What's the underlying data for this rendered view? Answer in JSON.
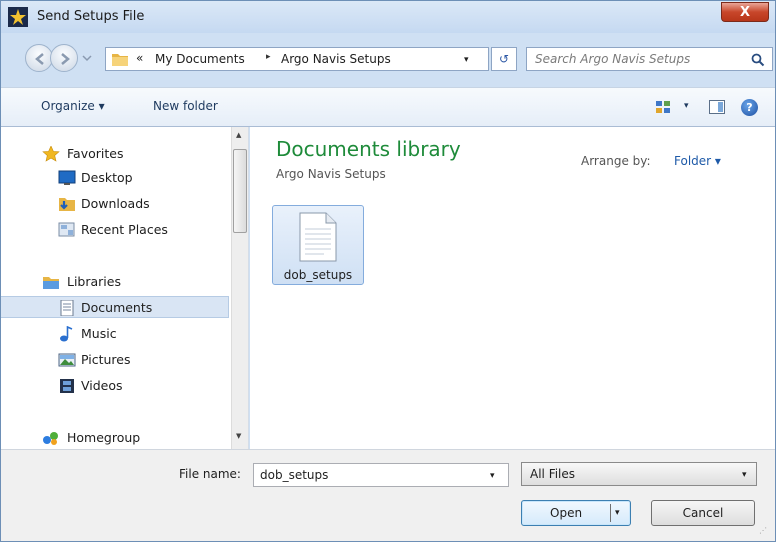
{
  "window": {
    "title": "Send Setups File",
    "close_glyph": "X"
  },
  "address": {
    "overflow": "«",
    "crumbs": [
      "My Documents",
      "Argo Navis Setups"
    ],
    "separator": "▸",
    "dropdown": "▾",
    "refresh_glyph": "↺"
  },
  "search": {
    "placeholder": "Search Argo Navis Setups"
  },
  "toolbar": {
    "organize": "Organize ▾",
    "new_folder": "New folder",
    "views_arrow": "▾",
    "help": "?"
  },
  "nav": {
    "items": [
      {
        "label": "Favorites",
        "icon": "star-icon"
      },
      {
        "label": "Desktop",
        "icon": "desktop-icon"
      },
      {
        "label": "Downloads",
        "icon": "downloads-folder-icon"
      },
      {
        "label": "Recent Places",
        "icon": "recent-places-icon"
      },
      {
        "label": "Libraries",
        "icon": "libraries-icon"
      },
      {
        "label": "Documents",
        "icon": "document-icon",
        "selected": true
      },
      {
        "label": "Music",
        "icon": "music-note-icon"
      },
      {
        "label": "Pictures",
        "icon": "picture-icon"
      },
      {
        "label": "Videos",
        "icon": "film-icon"
      },
      {
        "label": "Homegroup",
        "icon": "homegroup-icon"
      }
    ]
  },
  "content": {
    "title": "Documents library",
    "subtitle": "Argo Navis Setups",
    "arrange_label": "Arrange by:",
    "arrange_value": "Folder ▾",
    "files": [
      {
        "name": "dob_setups",
        "icon": "text-file-icon",
        "selected": true
      }
    ]
  },
  "footer": {
    "file_name_label": "File name:",
    "file_name_value": "dob_setups",
    "dropdown_arrow": "▾",
    "filter_value": "All Files",
    "open_label": "Open",
    "cancel_label": "Cancel",
    "grip": "⋰"
  },
  "colors": {
    "accent": "#1e8b3a",
    "link": "#1e5aa8",
    "selection": "#d9e5f4"
  }
}
